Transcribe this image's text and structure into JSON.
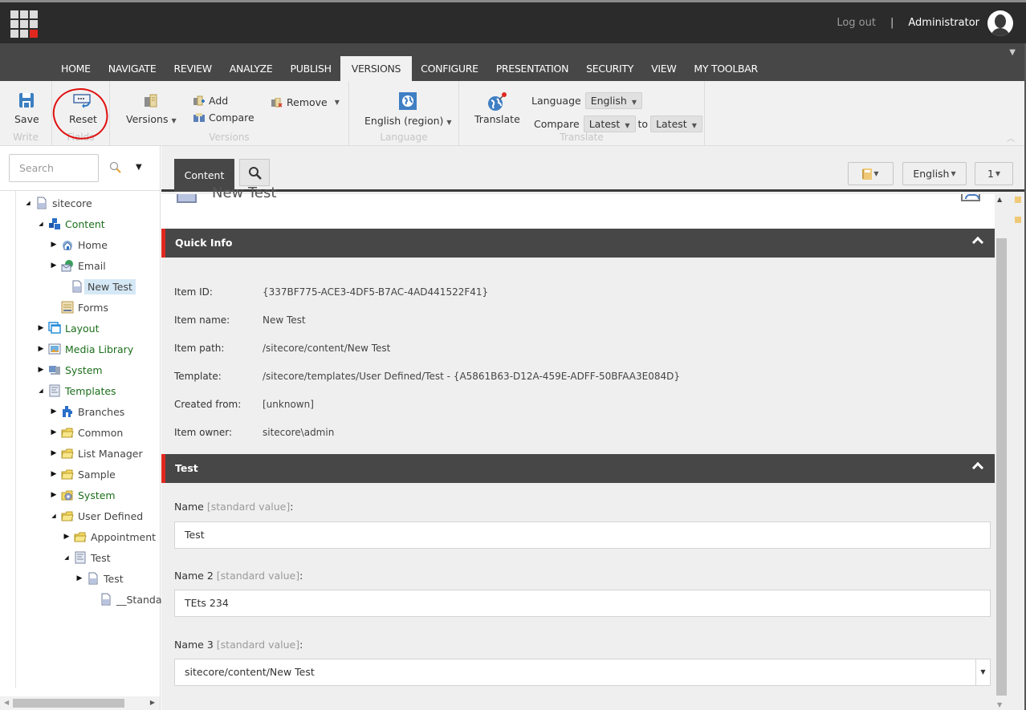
{
  "header": {
    "logout_label": "Log out",
    "separator": "|",
    "user_name": "Administrator"
  },
  "ribbon_tabs": [
    {
      "label": "HOME",
      "active": false
    },
    {
      "label": "NAVIGATE",
      "active": false
    },
    {
      "label": "REVIEW",
      "active": false
    },
    {
      "label": "ANALYZE",
      "active": false
    },
    {
      "label": "PUBLISH",
      "active": false
    },
    {
      "label": "VERSIONS",
      "active": true
    },
    {
      "label": "CONFIGURE",
      "active": false
    },
    {
      "label": "PRESENTATION",
      "active": false
    },
    {
      "label": "SECURITY",
      "active": false
    },
    {
      "label": "VIEW",
      "active": false
    },
    {
      "label": "MY TOOLBAR",
      "active": false
    }
  ],
  "ribbon": {
    "write": {
      "label": "Write",
      "save": "Save"
    },
    "fields": {
      "label": "Fields",
      "reset": "Reset",
      "annotation": "red circle around Reset"
    },
    "versions": {
      "label": "Versions",
      "versions_btn": "Versions",
      "add": "Add",
      "compare": "Compare",
      "remove": "Remove"
    },
    "language": {
      "label": "Language",
      "current": "English (region)"
    },
    "translate": {
      "label": "Translate",
      "translate_btn": "Translate",
      "language_label": "Language",
      "language_value": "English",
      "compare_label": "Compare",
      "compare_from": "Latest",
      "to_label": "to",
      "compare_to": "Latest"
    }
  },
  "search": {
    "placeholder": "Search"
  },
  "tree": [
    {
      "label": "sitecore",
      "toggle": "expanded",
      "icon": "document-icon",
      "green": false
    },
    {
      "label": "Content",
      "toggle": "expanded",
      "icon": "content-cubes-icon",
      "green": true
    },
    {
      "label": "Home",
      "toggle": "collapsed",
      "icon": "home-icon",
      "green": false
    },
    {
      "label": "Email",
      "toggle": "collapsed",
      "icon": "email-globe-icon",
      "green": false
    },
    {
      "label": "New Test",
      "toggle": "none",
      "icon": "document-icon",
      "green": false,
      "selected": true
    },
    {
      "label": "Forms",
      "toggle": "none",
      "icon": "forms-icon",
      "green": false
    },
    {
      "label": "Layout",
      "toggle": "collapsed",
      "icon": "layout-icon",
      "green": true
    },
    {
      "label": "Media Library",
      "toggle": "collapsed",
      "icon": "media-library-icon",
      "green": true
    },
    {
      "label": "System",
      "toggle": "collapsed",
      "icon": "system-icon",
      "green": true
    },
    {
      "label": "Templates",
      "toggle": "expanded",
      "icon": "template-icon",
      "green": true
    },
    {
      "label": "Branches",
      "toggle": "collapsed",
      "icon": "branches-icon",
      "green": false
    },
    {
      "label": "Common",
      "toggle": "collapsed",
      "icon": "folder-icon",
      "green": false
    },
    {
      "label": "List Manager",
      "toggle": "collapsed",
      "icon": "folder-icon",
      "green": false
    },
    {
      "label": "Sample",
      "toggle": "collapsed",
      "icon": "folder-icon",
      "green": false
    },
    {
      "label": "System",
      "toggle": "collapsed",
      "icon": "system-folder-icon",
      "green": true
    },
    {
      "label": "User Defined",
      "toggle": "expanded",
      "icon": "folder-icon",
      "green": false
    },
    {
      "label": "Appointment",
      "toggle": "collapsed",
      "icon": "folder-icon",
      "green": false
    },
    {
      "label": "Test",
      "toggle": "expanded",
      "icon": "template-icon",
      "green": false
    },
    {
      "label": "Test",
      "toggle": "collapsed",
      "icon": "document-icon",
      "green": false
    },
    {
      "label": "__Standard Values",
      "toggle": "none",
      "icon": "document-icon",
      "green": false
    }
  ],
  "editor": {
    "content_tab": "Content",
    "language_btn": "English",
    "version_btn": "1",
    "item_title": "New Test",
    "quick_info": {
      "title": "Quick Info",
      "rows": [
        {
          "key": "Item ID:",
          "value": "{337BF775-ACE3-4DF5-B7AC-4AD441522F41}"
        },
        {
          "key": "Item name:",
          "value": "New Test"
        },
        {
          "key": "Item path:",
          "value": "/sitecore/content/New Test"
        },
        {
          "key": "Template:",
          "value": "/sitecore/templates/User Defined/Test - {A5861B63-D12A-459E-ADFF-50BFAA3E084D}"
        },
        {
          "key": "Created from:",
          "value": "[unknown]"
        },
        {
          "key": "Item owner:",
          "value": "sitecore\\admin"
        }
      ]
    },
    "test_section": {
      "title": "Test",
      "fields": [
        {
          "label": "Name",
          "std": "[standard value]",
          "colon": ":",
          "value": "Test"
        },
        {
          "label": "Name 2",
          "std": "[standard value]",
          "colon": ":",
          "value": "TEts 234"
        },
        {
          "label": "Name 3",
          "std": "[standard value]",
          "colon": ":",
          "value": "sitecore/content/New Test"
        }
      ]
    }
  }
}
